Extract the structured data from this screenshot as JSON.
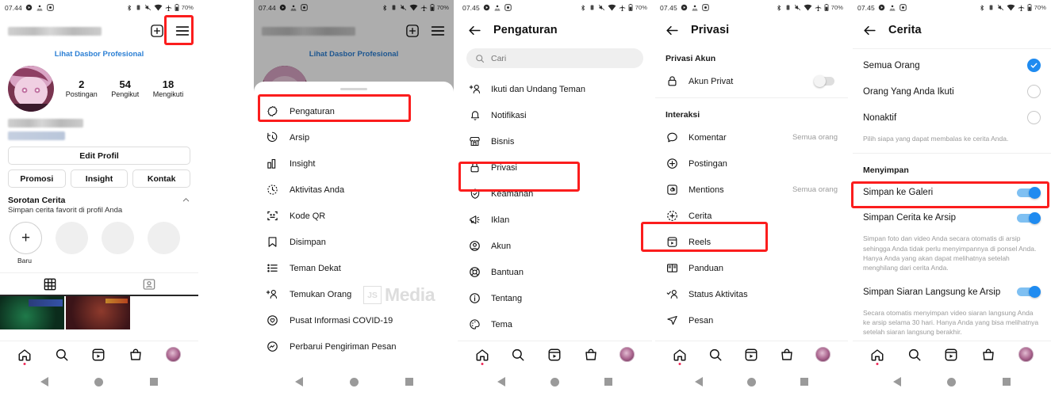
{
  "meta": {
    "watermark": {
      "badge": "JS",
      "text": "Media"
    },
    "accent_blue": "#1f8bf0",
    "link_blue": "#2b7fd4",
    "annotation_red": "#fb1d1d"
  },
  "status_bar": {
    "time_early": "07.44",
    "time_late": "07.45",
    "battery": "70%",
    "data_badge": "12"
  },
  "panel1": {
    "name": "profile",
    "dashboard_link": "Lihat Dasbor Profesional",
    "stats": [
      {
        "num": "2",
        "label": "Postingan"
      },
      {
        "num": "54",
        "label": "Pengikut"
      },
      {
        "num": "18",
        "label": "Mengikuti"
      }
    ],
    "edit_profile": "Edit Profil",
    "buttons": [
      "Promosi",
      "Insight",
      "Kontak"
    ],
    "highlights": {
      "title": "Sorotan Cerita",
      "subtitle": "Simpan cerita favorit di profil Anda",
      "new_label": "Baru",
      "plus": "+"
    }
  },
  "panel2": {
    "name": "menu-drawer",
    "dashboard_link": "Lihat Dasbor Profesional",
    "items": [
      {
        "label": "Pengaturan",
        "icon": "gear-icon"
      },
      {
        "label": "Arsip",
        "icon": "archive-clock-icon"
      },
      {
        "label": "Insight",
        "icon": "bar-chart-icon"
      },
      {
        "label": "Aktivitas Anda",
        "icon": "activity-clock-icon"
      },
      {
        "label": "Kode QR",
        "icon": "qr-code-icon"
      },
      {
        "label": "Disimpan",
        "icon": "bookmark-icon"
      },
      {
        "label": "Teman Dekat",
        "icon": "close-friends-list-icon"
      },
      {
        "label": "Temukan Orang",
        "icon": "add-person-icon"
      },
      {
        "label": "Pusat Informasi COVID-19",
        "icon": "covid-info-icon"
      },
      {
        "label": "Perbarui Pengiriman Pesan",
        "icon": "messenger-icon"
      }
    ]
  },
  "panel3": {
    "name": "settings",
    "title": "Pengaturan",
    "search_placeholder": "Cari",
    "items": [
      {
        "label": "Ikuti dan Undang Teman",
        "icon": "add-person-icon"
      },
      {
        "label": "Notifikasi",
        "icon": "bell-icon"
      },
      {
        "label": "Bisnis",
        "icon": "store-icon"
      },
      {
        "label": "Privasi",
        "icon": "lock-icon"
      },
      {
        "label": "Keamanan",
        "icon": "shield-check-icon"
      },
      {
        "label": "Iklan",
        "icon": "megaphone-icon"
      },
      {
        "label": "Akun",
        "icon": "account-circle-icon"
      },
      {
        "label": "Bantuan",
        "icon": "lifebuoy-icon"
      },
      {
        "label": "Tentang",
        "icon": "info-circle-icon"
      },
      {
        "label": "Tema",
        "icon": "palette-icon"
      }
    ]
  },
  "panel4": {
    "name": "privacy",
    "title": "Privasi",
    "section_account": "Privasi Akun",
    "private_account": {
      "label": "Akun Privat",
      "icon": "lock-icon",
      "on": false
    },
    "section_interaction": "Interaksi",
    "items": [
      {
        "label": "Komentar",
        "icon": "comment-icon",
        "value": "Semua orang"
      },
      {
        "label": "Postingan",
        "icon": "plus-circle-icon",
        "value": ""
      },
      {
        "label": "Mentions",
        "icon": "at-icon",
        "value": "Semua orang"
      },
      {
        "label": "Cerita",
        "icon": "story-plus-icon",
        "value": ""
      },
      {
        "label": "Reels",
        "icon": "reels-icon",
        "value": ""
      },
      {
        "label": "Panduan",
        "icon": "guide-book-icon",
        "value": ""
      },
      {
        "label": "Status Aktivitas",
        "icon": "activity-status-icon",
        "value": ""
      },
      {
        "label": "Pesan",
        "icon": "send-icon",
        "value": ""
      }
    ]
  },
  "panel5": {
    "name": "story-settings",
    "title": "Cerita",
    "options": [
      {
        "label": "Semua Orang",
        "checked": true
      },
      {
        "label": "Orang Yang Anda Ikuti",
        "checked": false
      },
      {
        "label": "Nonaktif",
        "checked": false
      }
    ],
    "options_hint": "Pilih siapa yang dapat membalas ke cerita Anda.",
    "section_saving": "Menyimpan",
    "toggles": [
      {
        "label": "Simpan ke Galeri",
        "on": true,
        "hint": ""
      },
      {
        "label": "Simpan Cerita ke Arsip",
        "on": true,
        "hint": "Simpan foto dan video Anda secara otomatis di arsip sehingga Anda tidak perlu menyimpannya di ponsel Anda. Hanya Anda yang akan dapat melihatnya setelah menghilang dari cerita Anda."
      },
      {
        "label": "Simpan Siaran Langsung ke Arsip",
        "on": true,
        "hint": "Secara otomatis menyimpan video siaran langsung Anda ke arsip selama 30 hari. Hanya Anda yang bisa melihatnya setelah siaran langsung berakhir."
      }
    ]
  },
  "bottom_nav": {
    "items": [
      "home-icon",
      "search-icon",
      "reels-icon",
      "shop-icon",
      "profile-avatar"
    ]
  },
  "system_nav": {
    "items": [
      "back-triangle",
      "home-circle",
      "recents-square"
    ]
  }
}
